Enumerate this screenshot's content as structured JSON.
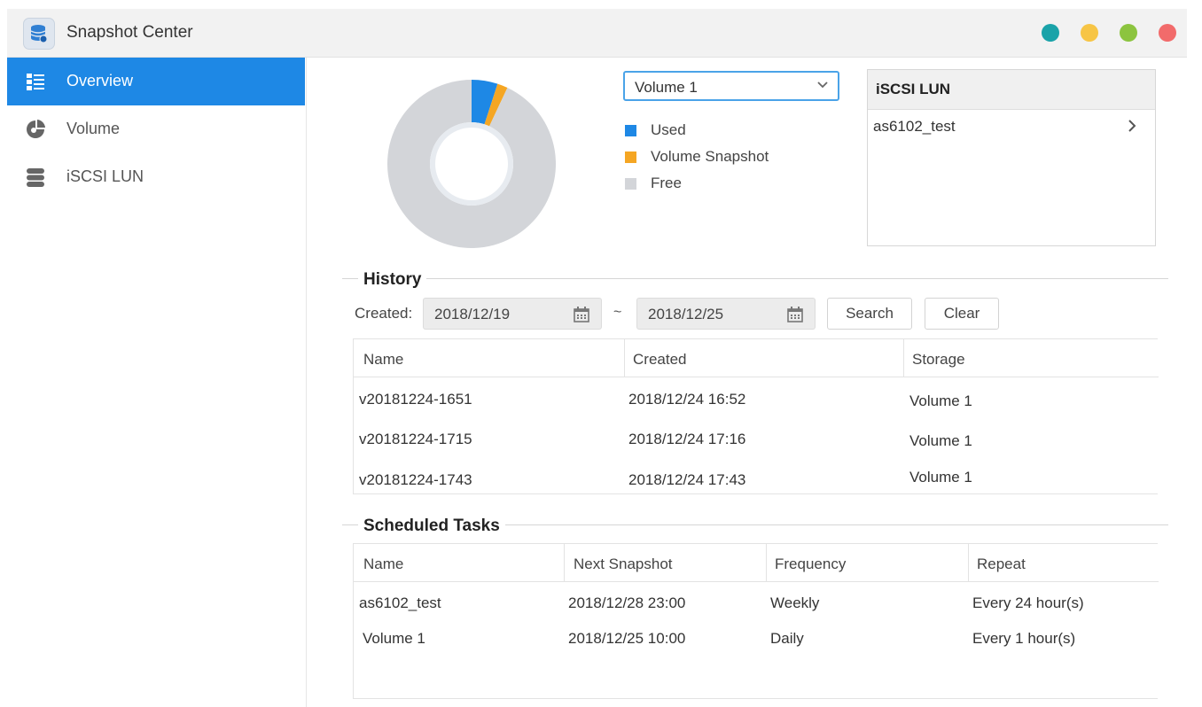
{
  "window": {
    "title": "Snapshot Center",
    "controls": [
      {
        "name": "teal",
        "color": "#1aa3a9"
      },
      {
        "name": "yellow",
        "color": "#f7c545"
      },
      {
        "name": "green",
        "color": "#8cc43f"
      },
      {
        "name": "red",
        "color": "#f26b6b"
      }
    ]
  },
  "sidebar": {
    "items": [
      {
        "label": "Overview",
        "icon": "overview-list-icon",
        "active": true
      },
      {
        "label": "Volume",
        "icon": "volume-pie-icon",
        "active": false
      },
      {
        "label": "iSCSI LUN",
        "icon": "database-stack-icon",
        "active": false
      }
    ]
  },
  "volume_selector": {
    "selected": "Volume 1"
  },
  "usage_chart": {
    "slices": [
      {
        "label": "Used",
        "fraction": 0.05,
        "color": "#1e88e5"
      },
      {
        "label": "Volume Snapshot",
        "fraction": 0.02,
        "color": "#f5a623"
      },
      {
        "label": "Free",
        "fraction": 0.93,
        "color": "#d3d5d9"
      }
    ]
  },
  "lun_panel": {
    "title": "iSCSI LUN",
    "items": [
      "as6102_test"
    ]
  },
  "history": {
    "title": "History",
    "created_label": "Created:",
    "from_date": "2018/12/19",
    "separator": "~",
    "to_date": "2018/12/25",
    "search_label": "Search",
    "clear_label": "Clear",
    "columns": [
      "Name",
      "Created",
      "Storage"
    ],
    "rows": [
      [
        "v20181224-1651",
        "2018/12/24 16:52",
        "Volume 1"
      ],
      [
        "v20181224-1715",
        "2018/12/24 17:16",
        "Volume 1"
      ],
      [
        "v20181224-1743",
        "2018/12/24 17:43",
        "Volume 1"
      ]
    ]
  },
  "scheduled": {
    "title": "Scheduled Tasks",
    "columns": [
      "Name",
      "Next Snapshot",
      "Frequency",
      "Repeat"
    ],
    "rows": [
      [
        "as6102_test",
        "2018/12/28 23:00",
        "Weekly",
        "Every 24 hour(s)"
      ],
      [
        "Volume 1",
        "2018/12/25 10:00",
        "Daily",
        "Every 1 hour(s)"
      ]
    ]
  }
}
